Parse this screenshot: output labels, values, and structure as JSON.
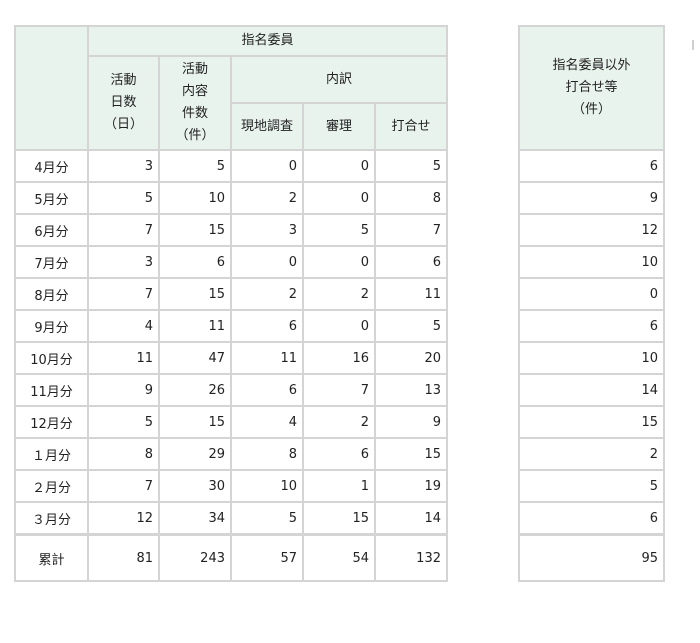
{
  "headers": {
    "committee": "指名委員",
    "activity_days": [
      "活動",
      "日数",
      "（日）"
    ],
    "activity_items": [
      "活動",
      "内容",
      "件数",
      "（件）"
    ],
    "breakdown": "内訳",
    "site_survey": "現地調査",
    "deliberation": "審理",
    "meeting": "打合せ",
    "other": [
      "指名委員以外",
      "打合せ等",
      "（件）"
    ]
  },
  "rows": [
    {
      "label": "4月分",
      "days": "3",
      "items": "5",
      "survey": "0",
      "review": "0",
      "meet": "5",
      "other": "6"
    },
    {
      "label": "5月分",
      "days": "5",
      "items": "10",
      "survey": "2",
      "review": "0",
      "meet": "8",
      "other": "9"
    },
    {
      "label": "6月分",
      "days": "7",
      "items": "15",
      "survey": "3",
      "review": "5",
      "meet": "7",
      "other": "12"
    },
    {
      "label": "7月分",
      "days": "3",
      "items": "6",
      "survey": "0",
      "review": "0",
      "meet": "6",
      "other": "10"
    },
    {
      "label": "8月分",
      "days": "7",
      "items": "15",
      "survey": "2",
      "review": "2",
      "meet": "11",
      "other": "0"
    },
    {
      "label": "9月分",
      "days": "4",
      "items": "11",
      "survey": "6",
      "review": "0",
      "meet": "5",
      "other": "6"
    },
    {
      "label": "10月分",
      "days": "11",
      "items": "47",
      "survey": "11",
      "review": "16",
      "meet": "20",
      "other": "10"
    },
    {
      "label": "11月分",
      "days": "9",
      "items": "26",
      "survey": "6",
      "review": "7",
      "meet": "13",
      "other": "14"
    },
    {
      "label": "12月分",
      "days": "5",
      "items": "15",
      "survey": "4",
      "review": "2",
      "meet": "9",
      "other": "15"
    },
    {
      "label": "１月分",
      "days": "8",
      "items": "29",
      "survey": "8",
      "review": "6",
      "meet": "15",
      "other": "2"
    },
    {
      "label": "２月分",
      "days": "7",
      "items": "30",
      "survey": "10",
      "review": "1",
      "meet": "19",
      "other": "5"
    },
    {
      "label": "３月分",
      "days": "12",
      "items": "34",
      "survey": "5",
      "review": "15",
      "meet": "14",
      "other": "6"
    }
  ],
  "total": {
    "label": "累計",
    "days": "81",
    "items": "243",
    "survey": "57",
    "review": "54",
    "meet": "132",
    "other": "95"
  }
}
